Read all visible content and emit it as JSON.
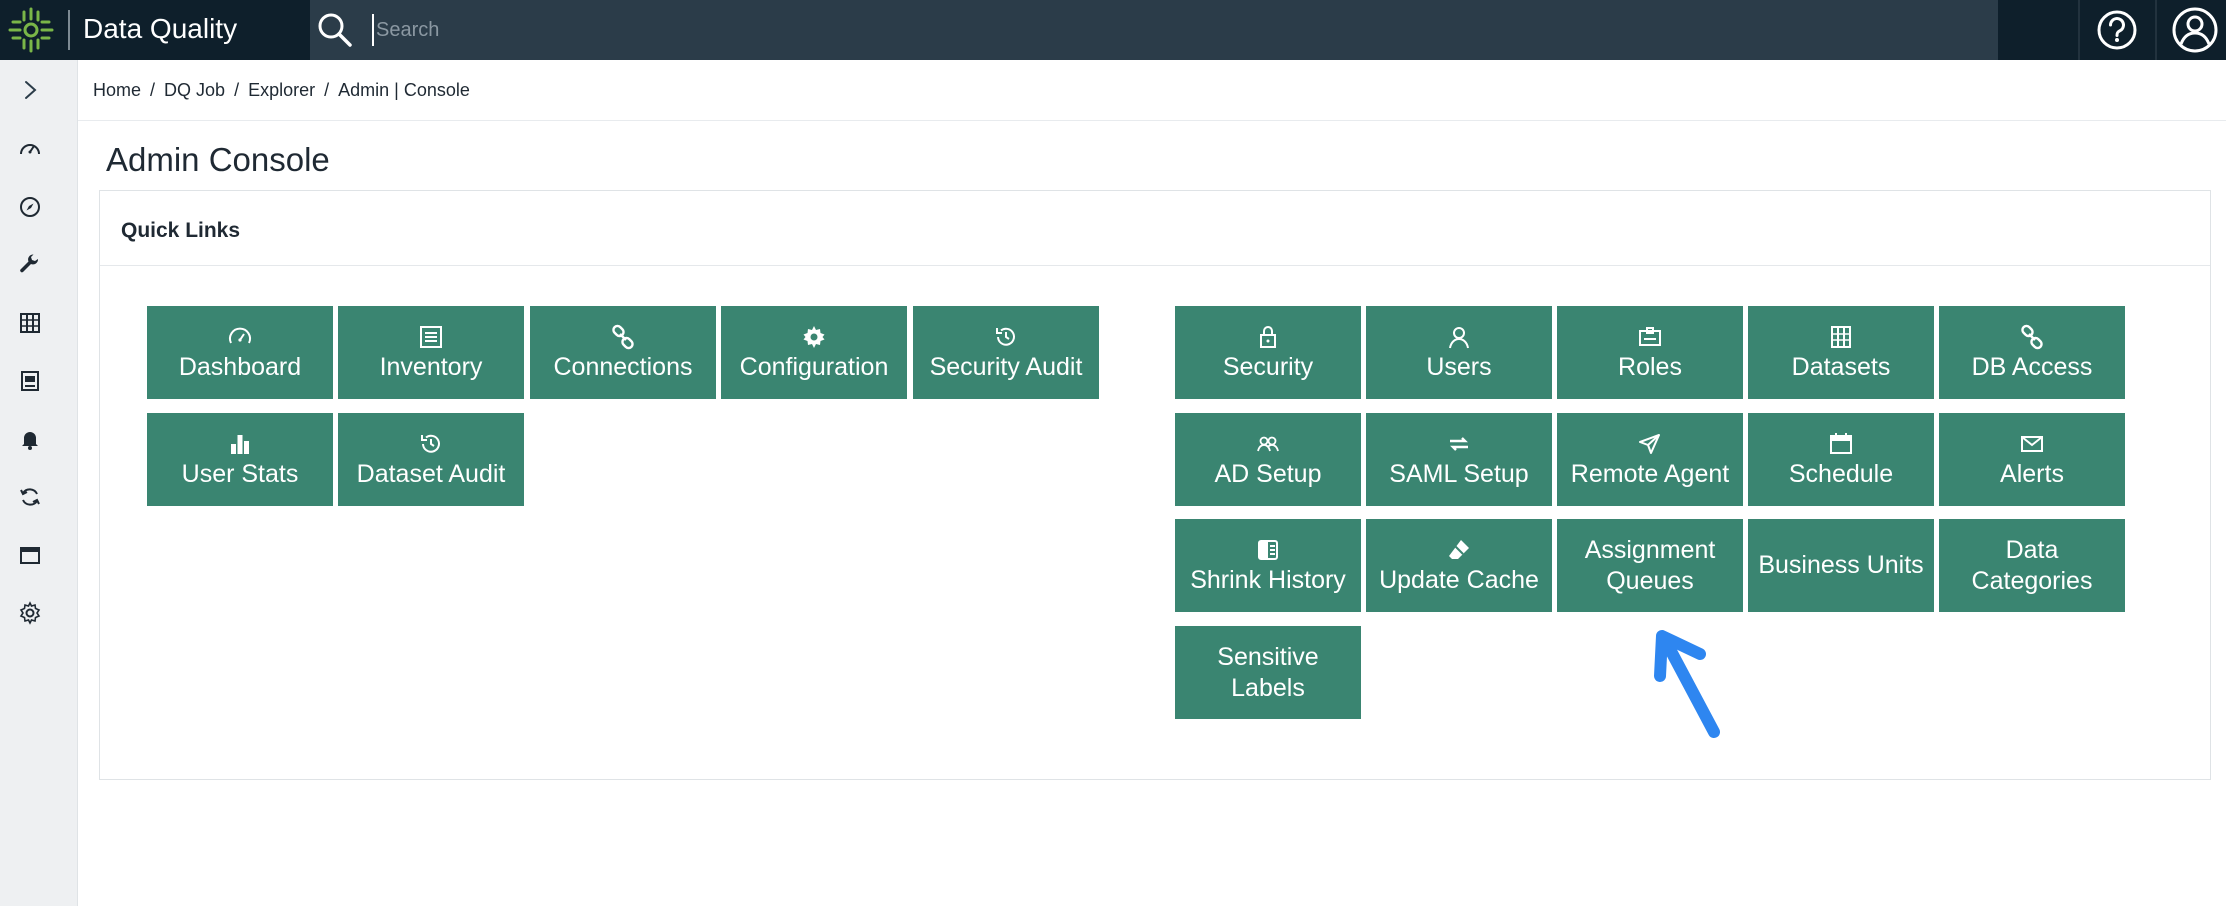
{
  "app": {
    "title": "Data Quality"
  },
  "search": {
    "placeholder": "Search",
    "value": ""
  },
  "breadcrumb": [
    {
      "label": "Home"
    },
    {
      "label": "DQ Job"
    },
    {
      "label": "Explorer"
    },
    {
      "label": "Admin | Console"
    }
  ],
  "breadcrumb_separator": "/",
  "page": {
    "title": "Admin Console"
  },
  "panel": {
    "title": "Quick Links"
  },
  "sidebar_icons": [
    "expand-chevron-icon",
    "dashboard-gauge-icon",
    "explorer-compass-icon",
    "wrench-icon",
    "catalog-icon",
    "reports-icon",
    "notifications-bell-icon",
    "sync-icon",
    "calendar-icon",
    "settings-gear-icon"
  ],
  "tiles_left": [
    {
      "label": "Dashboard",
      "icon": "gauge-icon"
    },
    {
      "label": "Inventory",
      "icon": "list-icon"
    },
    {
      "label": "Connections",
      "icon": "link-icon"
    },
    {
      "label": "Configuration",
      "icon": "gear-icon"
    },
    {
      "label": "Security Audit",
      "icon": "history-icon"
    },
    {
      "label": "User Stats",
      "icon": "bar-chart-icon"
    },
    {
      "label": "Dataset Audit",
      "icon": "history-icon"
    }
  ],
  "tiles_right": [
    {
      "label": "Security",
      "icon": "lock-icon"
    },
    {
      "label": "Users",
      "icon": "user-icon"
    },
    {
      "label": "Roles",
      "icon": "id-badge-icon"
    },
    {
      "label": "Datasets",
      "icon": "datasets-icon"
    },
    {
      "label": "DB Access",
      "icon": "link-icon"
    },
    {
      "label": "AD Setup",
      "icon": "users-icon"
    },
    {
      "label": "SAML Setup",
      "icon": "exchange-icon"
    },
    {
      "label": "Remote Agent",
      "icon": "send-icon"
    },
    {
      "label": "Schedule",
      "icon": "calendar-icon"
    },
    {
      "label": "Alerts",
      "icon": "envelope-icon"
    },
    {
      "label": "Shrink History",
      "icon": "shrink-icon"
    },
    {
      "label": "Update Cache",
      "icon": "eraser-icon"
    },
    {
      "label": "Assignment Queues",
      "icon": ""
    },
    {
      "label": "Business Units",
      "icon": ""
    },
    {
      "label": "Data Categories",
      "icon": ""
    },
    {
      "label": "Sensitive Labels",
      "icon": ""
    }
  ],
  "colors": {
    "topbar": "#0e1f2b",
    "searchbar": "#2b3c49",
    "tile": "#3a8571",
    "logo": "#7ab648",
    "annotation_arrow": "#2e86f0"
  }
}
